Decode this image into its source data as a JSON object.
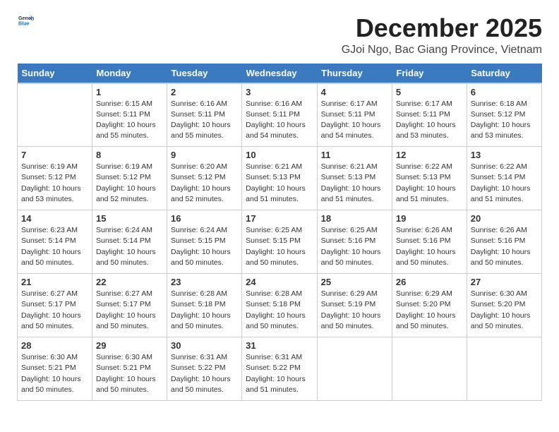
{
  "logo": {
    "text_general": "General",
    "text_blue": "Blue"
  },
  "header": {
    "month_title": "December 2025",
    "location": "GJoi Ngo, Bac Giang Province, Vietnam"
  },
  "weekdays": [
    "Sunday",
    "Monday",
    "Tuesday",
    "Wednesday",
    "Thursday",
    "Friday",
    "Saturday"
  ],
  "weeks": [
    [
      {
        "day": "",
        "info": ""
      },
      {
        "day": "1",
        "info": "Sunrise: 6:15 AM\nSunset: 5:11 PM\nDaylight: 10 hours\nand 55 minutes."
      },
      {
        "day": "2",
        "info": "Sunrise: 6:16 AM\nSunset: 5:11 PM\nDaylight: 10 hours\nand 55 minutes."
      },
      {
        "day": "3",
        "info": "Sunrise: 6:16 AM\nSunset: 5:11 PM\nDaylight: 10 hours\nand 54 minutes."
      },
      {
        "day": "4",
        "info": "Sunrise: 6:17 AM\nSunset: 5:11 PM\nDaylight: 10 hours\nand 54 minutes."
      },
      {
        "day": "5",
        "info": "Sunrise: 6:17 AM\nSunset: 5:11 PM\nDaylight: 10 hours\nand 53 minutes."
      },
      {
        "day": "6",
        "info": "Sunrise: 6:18 AM\nSunset: 5:12 PM\nDaylight: 10 hours\nand 53 minutes."
      }
    ],
    [
      {
        "day": "7",
        "info": "Sunrise: 6:19 AM\nSunset: 5:12 PM\nDaylight: 10 hours\nand 53 minutes."
      },
      {
        "day": "8",
        "info": "Sunrise: 6:19 AM\nSunset: 5:12 PM\nDaylight: 10 hours\nand 52 minutes."
      },
      {
        "day": "9",
        "info": "Sunrise: 6:20 AM\nSunset: 5:12 PM\nDaylight: 10 hours\nand 52 minutes."
      },
      {
        "day": "10",
        "info": "Sunrise: 6:21 AM\nSunset: 5:13 PM\nDaylight: 10 hours\nand 51 minutes."
      },
      {
        "day": "11",
        "info": "Sunrise: 6:21 AM\nSunset: 5:13 PM\nDaylight: 10 hours\nand 51 minutes."
      },
      {
        "day": "12",
        "info": "Sunrise: 6:22 AM\nSunset: 5:13 PM\nDaylight: 10 hours\nand 51 minutes."
      },
      {
        "day": "13",
        "info": "Sunrise: 6:22 AM\nSunset: 5:14 PM\nDaylight: 10 hours\nand 51 minutes."
      }
    ],
    [
      {
        "day": "14",
        "info": "Sunrise: 6:23 AM\nSunset: 5:14 PM\nDaylight: 10 hours\nand 50 minutes."
      },
      {
        "day": "15",
        "info": "Sunrise: 6:24 AM\nSunset: 5:14 PM\nDaylight: 10 hours\nand 50 minutes."
      },
      {
        "day": "16",
        "info": "Sunrise: 6:24 AM\nSunset: 5:15 PM\nDaylight: 10 hours\nand 50 minutes."
      },
      {
        "day": "17",
        "info": "Sunrise: 6:25 AM\nSunset: 5:15 PM\nDaylight: 10 hours\nand 50 minutes."
      },
      {
        "day": "18",
        "info": "Sunrise: 6:25 AM\nSunset: 5:16 PM\nDaylight: 10 hours\nand 50 minutes."
      },
      {
        "day": "19",
        "info": "Sunrise: 6:26 AM\nSunset: 5:16 PM\nDaylight: 10 hours\nand 50 minutes."
      },
      {
        "day": "20",
        "info": "Sunrise: 6:26 AM\nSunset: 5:16 PM\nDaylight: 10 hours\nand 50 minutes."
      }
    ],
    [
      {
        "day": "21",
        "info": "Sunrise: 6:27 AM\nSunset: 5:17 PM\nDaylight: 10 hours\nand 50 minutes."
      },
      {
        "day": "22",
        "info": "Sunrise: 6:27 AM\nSunset: 5:17 PM\nDaylight: 10 hours\nand 50 minutes."
      },
      {
        "day": "23",
        "info": "Sunrise: 6:28 AM\nSunset: 5:18 PM\nDaylight: 10 hours\nand 50 minutes."
      },
      {
        "day": "24",
        "info": "Sunrise: 6:28 AM\nSunset: 5:18 PM\nDaylight: 10 hours\nand 50 minutes."
      },
      {
        "day": "25",
        "info": "Sunrise: 6:29 AM\nSunset: 5:19 PM\nDaylight: 10 hours\nand 50 minutes."
      },
      {
        "day": "26",
        "info": "Sunrise: 6:29 AM\nSunset: 5:20 PM\nDaylight: 10 hours\nand 50 minutes."
      },
      {
        "day": "27",
        "info": "Sunrise: 6:30 AM\nSunset: 5:20 PM\nDaylight: 10 hours\nand 50 minutes."
      }
    ],
    [
      {
        "day": "28",
        "info": "Sunrise: 6:30 AM\nSunset: 5:21 PM\nDaylight: 10 hours\nand 50 minutes."
      },
      {
        "day": "29",
        "info": "Sunrise: 6:30 AM\nSunset: 5:21 PM\nDaylight: 10 hours\nand 50 minutes."
      },
      {
        "day": "30",
        "info": "Sunrise: 6:31 AM\nSunset: 5:22 PM\nDaylight: 10 hours\nand 50 minutes."
      },
      {
        "day": "31",
        "info": "Sunrise: 6:31 AM\nSunset: 5:22 PM\nDaylight: 10 hours\nand 51 minutes."
      },
      {
        "day": "",
        "info": ""
      },
      {
        "day": "",
        "info": ""
      },
      {
        "day": "",
        "info": ""
      }
    ]
  ]
}
